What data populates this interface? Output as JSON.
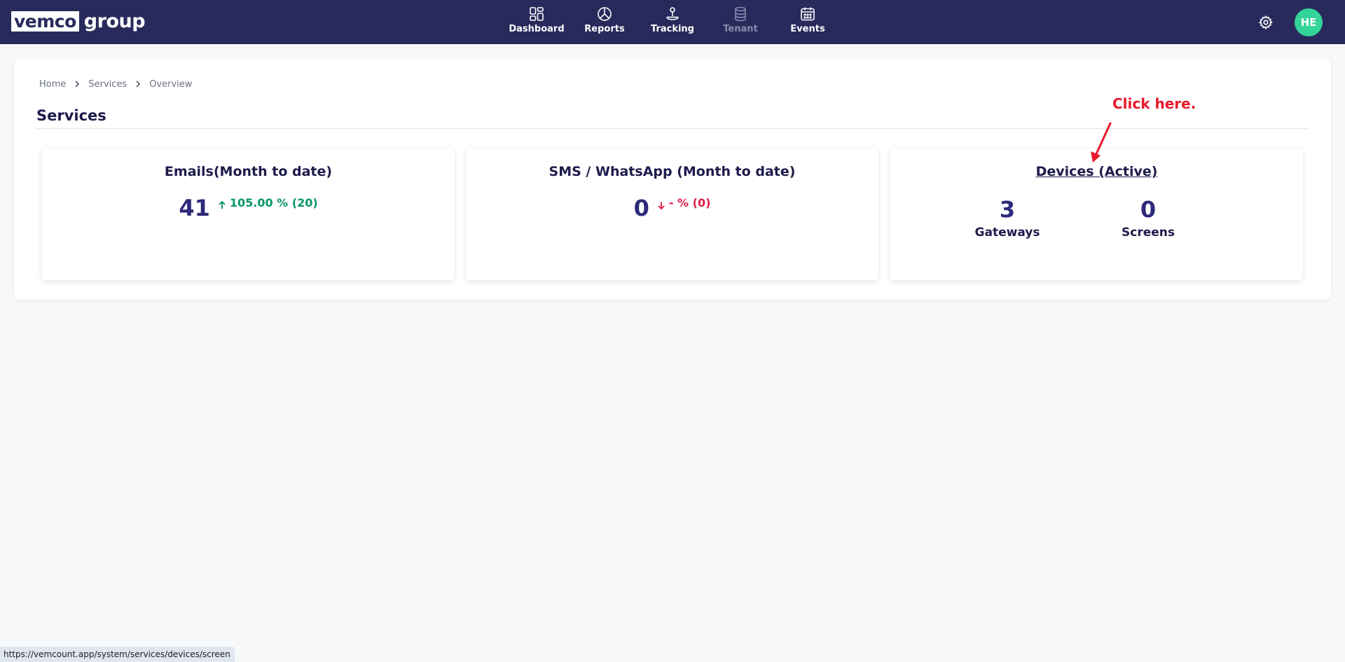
{
  "brand": {
    "logo_boxed": "vemco",
    "logo_plain": "group"
  },
  "nav": {
    "items": [
      {
        "label": "Dashboard",
        "icon": "dashboard-icon",
        "disabled": false
      },
      {
        "label": "Reports",
        "icon": "pie-chart-icon",
        "disabled": false
      },
      {
        "label": "Tracking",
        "icon": "location-pin-icon",
        "disabled": false
      },
      {
        "label": "Tenant",
        "icon": "database-icon",
        "disabled": true
      },
      {
        "label": "Events",
        "icon": "calendar-icon",
        "disabled": false
      }
    ],
    "settings_icon": "gear-icon",
    "avatar_initials": "HE",
    "avatar_color": "#34d399"
  },
  "breadcrumb": [
    "Home",
    "Services",
    "Overview"
  ],
  "page": {
    "title": "Services"
  },
  "cards": {
    "emails": {
      "title": "Emails(Month to date)",
      "value": "41",
      "trend_direction": "up",
      "trend_text": "105.00 % (20)"
    },
    "sms": {
      "title": "SMS / WhatsApp (Month to date)",
      "value": "0",
      "trend_direction": "down",
      "trend_text": "- % (0)"
    },
    "devices": {
      "title": "Devices (Active)",
      "gateways_value": "3",
      "gateways_label": "Gateways",
      "screens_value": "0",
      "screens_label": "Screens"
    }
  },
  "annotation": {
    "text": "Click here.",
    "color": "#e8192c"
  },
  "status_bar": {
    "url": "https://vemcount.app/system/services/devices/screen"
  },
  "colors": {
    "nav_bg": "#282a5c",
    "trend_up": "#059669",
    "trend_down": "#e11d48",
    "value_text": "#2e2a7a"
  }
}
